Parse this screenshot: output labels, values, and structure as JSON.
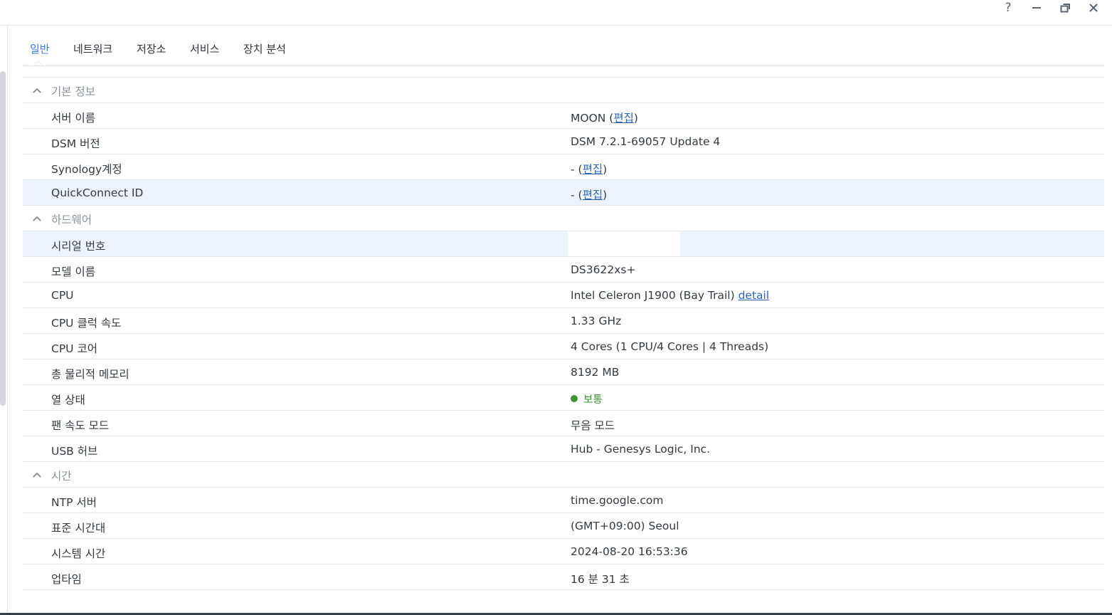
{
  "window": {
    "help_label": "?"
  },
  "tabs": [
    {
      "label": "일반",
      "active": true
    },
    {
      "label": "네트워크",
      "active": false
    },
    {
      "label": "저장소",
      "active": false
    },
    {
      "label": "서비스",
      "active": false
    },
    {
      "label": "장치 분석",
      "active": false
    }
  ],
  "sections": {
    "basic": {
      "title": "기본 정보",
      "server_name": {
        "label": "서버 이름",
        "value": "MOON",
        "edit": "편집"
      },
      "dsm_version": {
        "label": "DSM 버전",
        "value": "DSM 7.2.1-69057 Update 4"
      },
      "synology_account": {
        "label": "Synology계정",
        "value": "-",
        "edit": "편집"
      },
      "quickconnect": {
        "label": "QuickConnect ID",
        "value": "-",
        "edit": "편집"
      }
    },
    "hardware": {
      "title": "하드웨어",
      "serial": {
        "label": "시리얼 번호",
        "value": ""
      },
      "model": {
        "label": "모델 이름",
        "value": "DS3622xs+"
      },
      "cpu": {
        "label": "CPU",
        "value": "Intel Celeron J1900 (Bay Trail)",
        "detail": "detail"
      },
      "cpu_clock": {
        "label": "CPU 클럭 속도",
        "value": "1.33 GHz"
      },
      "cpu_cores": {
        "label": "CPU 코어",
        "value": "4 Cores (1 CPU/4 Cores | 4 Threads)"
      },
      "memory": {
        "label": "총 물리적 메모리",
        "value": "8192 MB"
      },
      "thermal": {
        "label": "열 상태",
        "value": "보통",
        "status_color": "#3a9a2e"
      },
      "fan_mode": {
        "label": "팬 속도 모드",
        "value": "무음 모드"
      },
      "usb_hub": {
        "label": "USB 허브",
        "value": "Hub - Genesys Logic, Inc."
      }
    },
    "time": {
      "title": "시간",
      "ntp": {
        "label": "NTP 서버",
        "value": "time.google.com"
      },
      "timezone": {
        "label": "표준 시간대",
        "value": "(GMT+09:00) Seoul"
      },
      "system_time": {
        "label": "시스템 시간",
        "value": "2024-08-20 16:53:36"
      },
      "uptime": {
        "label": "업타임",
        "value": "16 분 31 초"
      }
    }
  },
  "colors": {
    "accent": "#3c7bd8",
    "link": "#2d66b8",
    "highlight_row": "#edf3fd"
  }
}
